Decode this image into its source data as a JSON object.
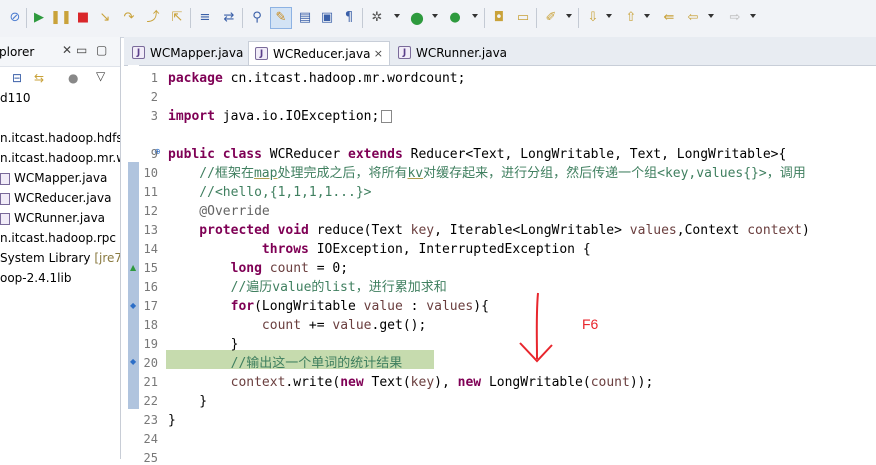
{
  "toolbar": {
    "icons": [
      "skip-breakpoints-icon",
      "resume-icon",
      "suspend-icon",
      "terminate-icon",
      "step-into-icon",
      "step-over-icon",
      "step-return-icon",
      "drop-to-frame-icon",
      "use-step-filters-icon",
      "toggle-breakpoint-icon",
      "highlight-icon",
      "properties-icon",
      "run-last-icon",
      "debug-icon",
      "run-icon",
      "coverage-icon",
      "new-package-icon",
      "open-type-icon",
      "search-icon",
      "next-annotation-icon",
      "prev-annotation-icon",
      "back-icon",
      "forward-icon"
    ]
  },
  "explorer": {
    "title": "plorer",
    "items": [
      {
        "label": "d110"
      },
      {
        "label": "n.itcast.hadoop.hdfs"
      },
      {
        "label": "n.itcast.hadoop.mr.w"
      },
      {
        "label": "WCMapper.java"
      },
      {
        "label": "WCReducer.java"
      },
      {
        "label": "WCRunner.java"
      },
      {
        "label": "n.itcast.hadoop.rpc"
      },
      {
        "label": "System Library",
        "badge": "[jre7]"
      },
      {
        "label": "oop-2.4.1lib"
      }
    ]
  },
  "editor": {
    "tabs": [
      {
        "label": "WCMapper.java",
        "close": ""
      },
      {
        "label": "WCReducer.java",
        "close": "×"
      },
      {
        "label": "WCRunner.java",
        "close": ""
      }
    ],
    "line_numbers": [
      "1",
      "2",
      "3",
      "9",
      "10",
      "11",
      "12",
      "13",
      "14",
      "15",
      "16",
      "17",
      "18",
      "19",
      "20",
      "21",
      "22",
      "23",
      "24",
      "25"
    ],
    "code": {
      "l1_kw": "package",
      "l1_rest": " cn.itcast.hadoop.mr.wordcount;",
      "l3_kw": "import",
      "l3_rest": " java.io.IOException;",
      "l9_a": "public class",
      "l9_b": " WCReducer ",
      "l9_c": "extends",
      "l9_d": " Reducer<Text, LongWritable, Text, LongWritable>{",
      "l10_a": "    //框架在",
      "l10_b": "map",
      "l10_c": "处理完成之后，将所有",
      "l10_d": "kv",
      "l10_e": "对缓存起来，进行分组，然后传递一个组<key,values{}>，调用",
      "l11": "    //<hello,{1,1,1,1...}>",
      "l12": "    @Override",
      "l13_a": "    protected void",
      "l13_b": " reduce(Text ",
      "l13_c": "key",
      "l13_d": ", Iterable<LongWritable> ",
      "l13_e": "values",
      "l13_f": ",Context ",
      "l13_g": "context",
      "l13_h": ")",
      "l14_a": "            throws",
      "l14_b": " IOException, InterruptedException {",
      "l15_a": "        long",
      "l15_b": " ",
      "l15_c": "count",
      "l15_d": " = 0;",
      "l16": "        //遍历value的list，进行累加求和",
      "l17_a": "        for",
      "l17_b": "(LongWritable ",
      "l17_c": "value",
      "l17_d": " : ",
      "l17_e": "values",
      "l17_f": "){",
      "l18_a": "            ",
      "l18_b": "count",
      "l18_c": " += ",
      "l18_d": "value",
      "l18_e": ".get();",
      "l19": "        }",
      "l20": "        //输出这一个单词的统计结果",
      "l21_a": "        ",
      "l21_b": "context",
      "l21_c": ".write(",
      "l21_d": "new",
      "l21_e": " Text(",
      "l21_f": "key",
      "l21_g": "), ",
      "l21_h": "new",
      "l21_i": " LongWritable(",
      "l21_j": "count",
      "l21_k": "));",
      "l22": "    }",
      "l23": "}"
    }
  },
  "annotation": {
    "label": "F6",
    "color": "#e8262d"
  }
}
